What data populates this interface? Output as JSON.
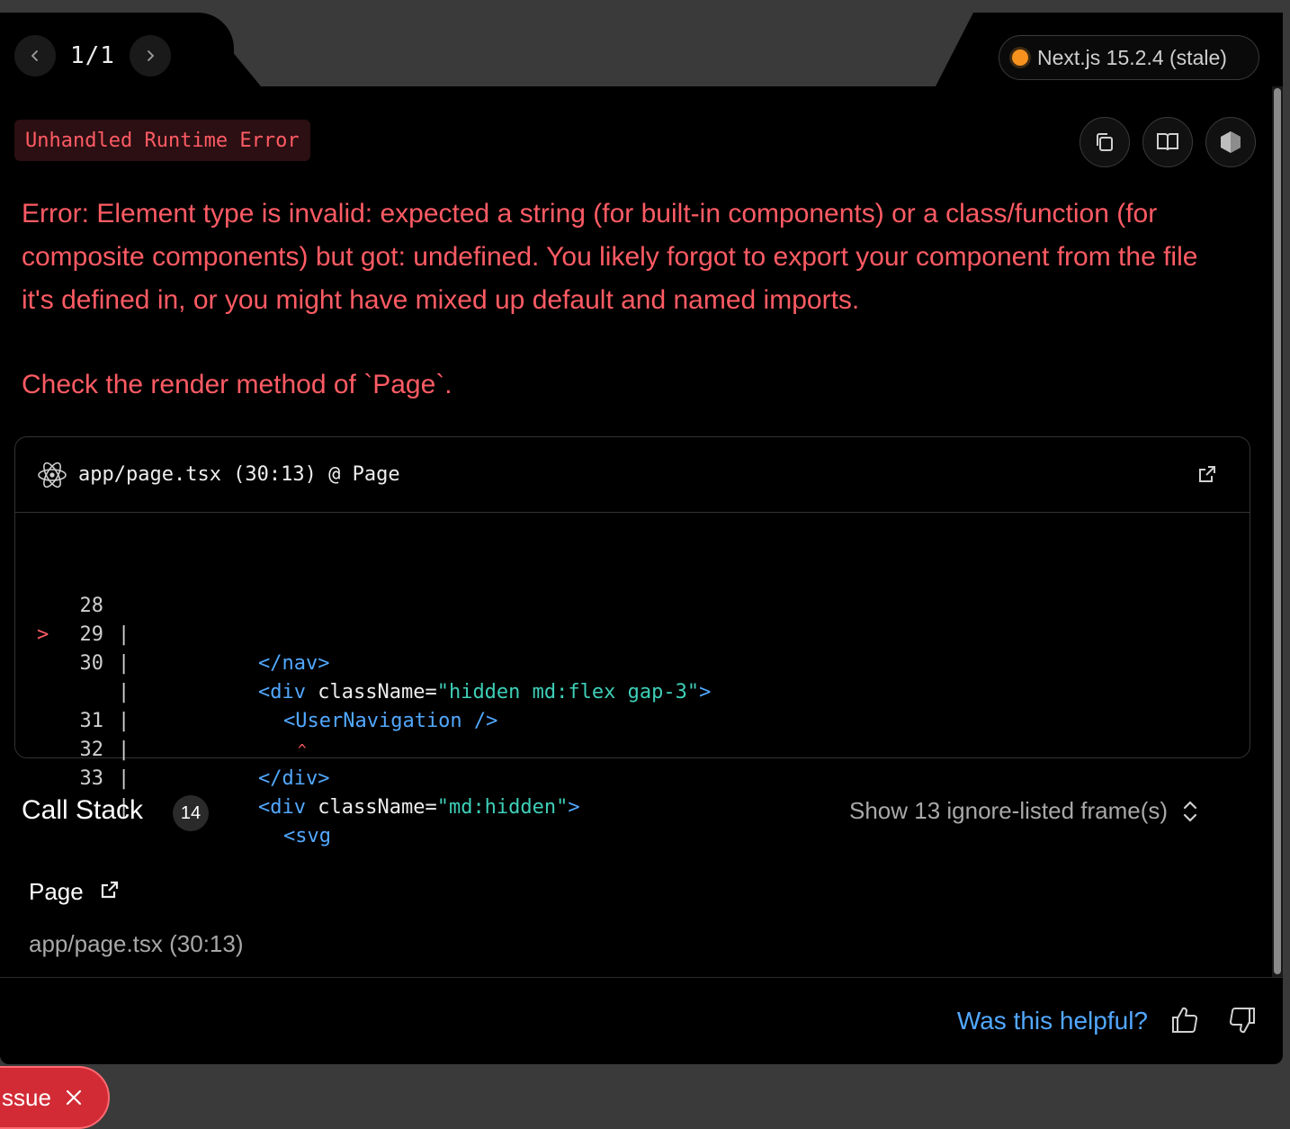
{
  "pager": {
    "prev_icon": "chevron-left-icon",
    "text": "1/1",
    "next_icon": "chevron-right-icon"
  },
  "version": {
    "label": "Next.js 15.2.4 (stale)",
    "status_color": "#f7921e"
  },
  "error": {
    "badge": "Unhandled Runtime Error",
    "message": "Error: Element type is invalid: expected a string (for built-in components) or a class/function (for composite components) but got: undefined. You likely forgot to export your component from the file it's defined in, or you might have mixed up default and named imports.",
    "check": "Check the render method of `Page`."
  },
  "toolbar": {
    "icons": [
      "copy-icon",
      "docs-book-icon",
      "nodejs-icon"
    ]
  },
  "code_frame": {
    "header": "app/page.tsx (30:13) @ Page",
    "lines": [
      {
        "marker": "",
        "num": "28",
        "pipe": "|"
      },
      {
        "marker": "",
        "num": "29",
        "pipe": "|"
      },
      {
        "marker": ">",
        "num": "30",
        "pipe": "|"
      },
      {
        "marker": "",
        "num": "",
        "pipe": "|"
      },
      {
        "marker": "",
        "num": "31",
        "pipe": "|"
      },
      {
        "marker": "",
        "num": "32",
        "pipe": "|"
      },
      {
        "marker": "",
        "num": "33",
        "pipe": "|"
      }
    ],
    "code": {
      "l28_tag": "</nav>",
      "l29_open": "<div ",
      "l29_attr": "className",
      "l29_eq": "=",
      "l29_str": "\"hidden md:flex gap-3\"",
      "l29_close": ">",
      "l30_tag": "<UserNavigation />",
      "caret": "^",
      "l31_tag": "</div>",
      "l32_open": "<div ",
      "l32_attr": "className",
      "l32_eq": "=",
      "l32_str": "\"md:hidden\"",
      "l32_close": ">",
      "l33_tag": "<svg"
    }
  },
  "call_stack": {
    "title": "Call Stack",
    "count": "14",
    "show_frames": "Show 13 ignore-listed frame(s)",
    "frame_name": "Page",
    "frame_file": "app/page.tsx (30:13)"
  },
  "footer": {
    "helpful": "Was this helpful?"
  },
  "issue": {
    "label": "ssue"
  }
}
